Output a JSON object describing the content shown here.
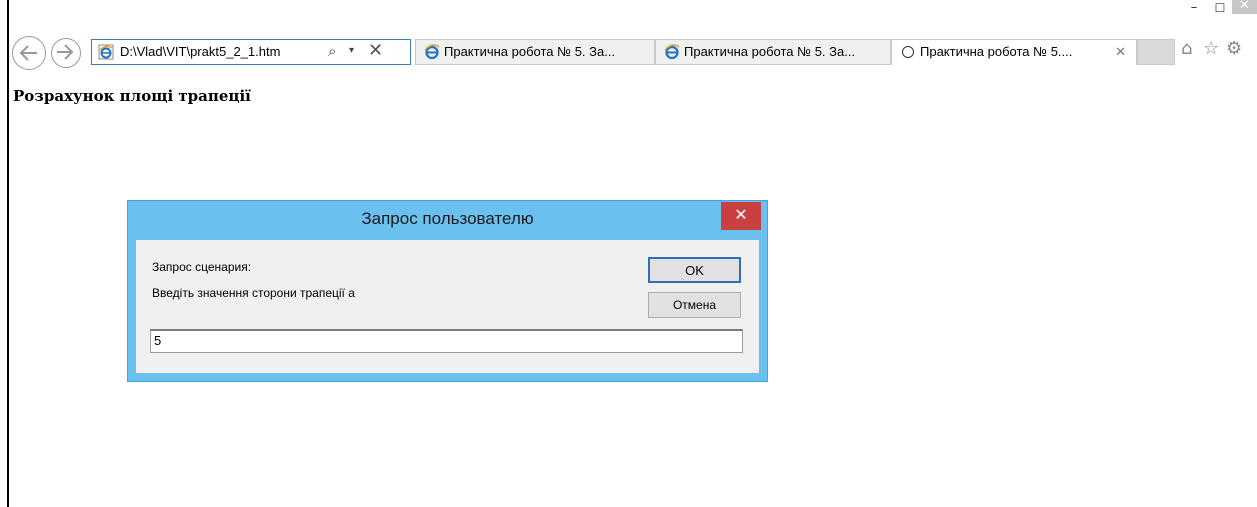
{
  "window": {
    "minimize_glyph": "–",
    "maximize_glyph": "☐",
    "close_glyph": "✕"
  },
  "toolbar": {
    "back_icon": "back-arrow-icon",
    "forward_icon": "forward-arrow-icon",
    "address": "D:\\Vlad\\VIT\\prakt5_2_1.htm",
    "search_glyph": "⌕",
    "dropdown_glyph": "▾",
    "stop_glyph": "✕"
  },
  "tabs": [
    {
      "label": "Практична робота № 5. За...",
      "active": false
    },
    {
      "label": "Практична робота № 5. За...",
      "active": false
    },
    {
      "label": "Практична робота № 5....",
      "active": true,
      "close_glyph": "✕"
    }
  ],
  "right_icons": {
    "home": "⌂",
    "favorites": "☆",
    "settings": "⚙"
  },
  "page": {
    "heading": "Розрахунок площі трапеції"
  },
  "dialog": {
    "title": "Запрос пользователю",
    "close_glyph": "✕",
    "script_prompt_label": "Запрос сценария:",
    "message": "Введіть значення сторони трапеції a",
    "ok_label": "OK",
    "cancel_label": "Отмена",
    "input_value": "5"
  },
  "colors": {
    "dialog_frame": "#6ac0ee",
    "dialog_close": "#c94040",
    "ok_focus_border": "#2f6fb5"
  }
}
